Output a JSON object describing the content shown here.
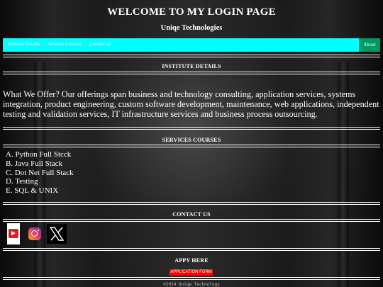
{
  "header": {
    "title": "WELCOME TO MY LOGIN PAGE",
    "subtitle": "Uniqe Technologies"
  },
  "nav": {
    "links": [
      "Institute Details",
      "Services Courses",
      "Contact us"
    ],
    "about": "About",
    "bar_color": "#00ffff",
    "about_color": "#009966"
  },
  "institute": {
    "heading": "INSTITUTE DETAILS",
    "text": "What We Offer? Our offerings span business and technology consulting, application services, systems integration, product engineering, custom software development, maintenance, web applications, independent testing and validation services, IT infrastructure services and business process outsourcing."
  },
  "services": {
    "heading": "SERVICES COURSES",
    "courses": [
      "A. Python Full Stcck",
      "B. Java Full Stack",
      "C. Dot Net Full Stack",
      "D. Testing",
      "E. SQL & UNIX"
    ]
  },
  "contact": {
    "heading": "CONTACT US",
    "icons": [
      "youtube-icon",
      "instagram-icon",
      "x-icon"
    ]
  },
  "apply": {
    "heading": "APPY HERE",
    "button": "APPLICATION FORM",
    "button_color": "#ff0000"
  },
  "footer": {
    "text": "©2024 Uniqe Technology"
  }
}
